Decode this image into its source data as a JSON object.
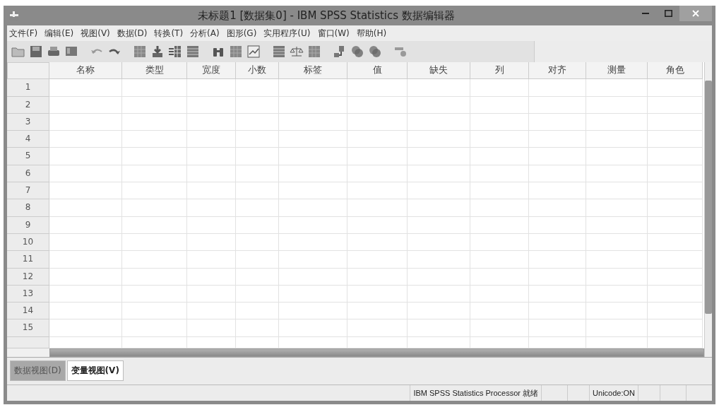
{
  "window": {
    "title": "未标题1 [数据集0] - IBM SPSS Statistics 数据编辑器"
  },
  "menu": [
    {
      "label": "文件(F)"
    },
    {
      "label": "编辑(E)"
    },
    {
      "label": "视图(V)"
    },
    {
      "label": "数据(D)"
    },
    {
      "label": "转换(T)"
    },
    {
      "label": "分析(A)"
    },
    {
      "label": "图形(G)"
    },
    {
      "label": "实用程序(U)"
    },
    {
      "label": "窗口(W)"
    },
    {
      "label": "帮助(H)"
    }
  ],
  "table": {
    "columns": [
      "名称",
      "类型",
      "宽度",
      "小数",
      "标签",
      "值",
      "缺失",
      "列",
      "对齐",
      "测量",
      "角色"
    ],
    "rows": [
      "1",
      "2",
      "3",
      "4",
      "5",
      "6",
      "7",
      "8",
      "9",
      "10",
      "11",
      "12",
      "13",
      "14",
      "15"
    ]
  },
  "tabs": [
    {
      "label": "数据视图(D)",
      "selected": false
    },
    {
      "label": "变量视图(V)",
      "selected": true
    }
  ],
  "status_bar": {
    "processor": "IBM SPSS Statistics Processor 就绪",
    "encoding": "Unicode:ON"
  }
}
